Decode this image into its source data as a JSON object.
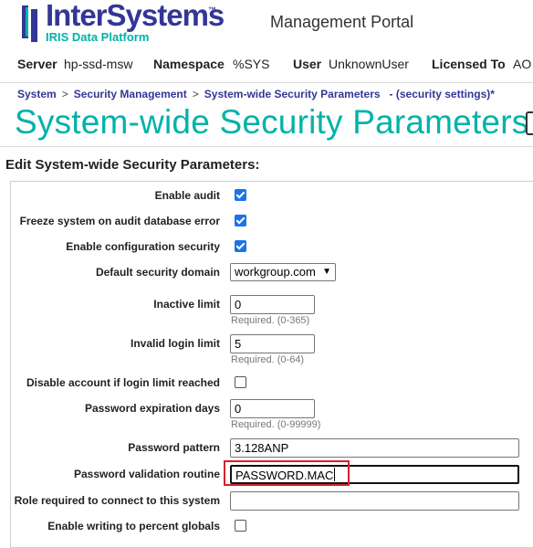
{
  "header": {
    "brand_name": "InterSystems",
    "brand_tm": "™",
    "brand_sub": "IRIS Data Platform",
    "portal_title": "Management Portal"
  },
  "infobar": {
    "server_label": "Server",
    "server_value": "hp-ssd-msw",
    "namespace_label": "Namespace",
    "namespace_value": "%SYS",
    "user_label": "User",
    "user_value": "UnknownUser",
    "licensed_label": "Licensed To",
    "licensed_value": "AO"
  },
  "breadcrumb": {
    "items": [
      "System",
      "Security Management",
      "System-wide Security Parameters"
    ],
    "separator": ">",
    "note": "- (security settings)*"
  },
  "page_title": "System-wide Security Parameters",
  "section_heading": "Edit System-wide Security Parameters:",
  "form": {
    "enable_audit_label": "Enable audit",
    "freeze_system_label": "Freeze system on audit database error",
    "enable_config_security_label": "Enable configuration security",
    "default_domain_label": "Default security domain",
    "default_domain_value": "workgroup.com",
    "inactive_limit_label": "Inactive limit",
    "inactive_limit_value": "0",
    "inactive_limit_hint": "Required. (0-365)",
    "invalid_login_label": "Invalid login limit",
    "invalid_login_value": "5",
    "invalid_login_hint": "Required. (0-64)",
    "disable_account_label": "Disable account if login limit reached",
    "password_expiration_label": "Password expiration days",
    "password_expiration_value": "0",
    "password_expiration_hint": "Required. (0-99999)",
    "password_pattern_label": "Password pattern",
    "password_pattern_value": "3.128ANP",
    "password_validation_label": "Password validation routine",
    "password_validation_value": "PASSWORD.MAC",
    "role_required_label": "Role required to connect to this system",
    "role_required_value": "",
    "partial_label": "Enable writing to percent globals"
  },
  "checkboxes": {
    "enable_audit": true,
    "freeze_system": true,
    "enable_config_security": true,
    "disable_account": false
  },
  "colors": {
    "brand": "#333695",
    "accent": "#00b2a9",
    "highlight": "#d9202f",
    "checkbox": "#1a73e8"
  },
  "icons": {
    "logo": "intersystems-logo-icon",
    "select_arrow": "chevron-down-icon"
  }
}
